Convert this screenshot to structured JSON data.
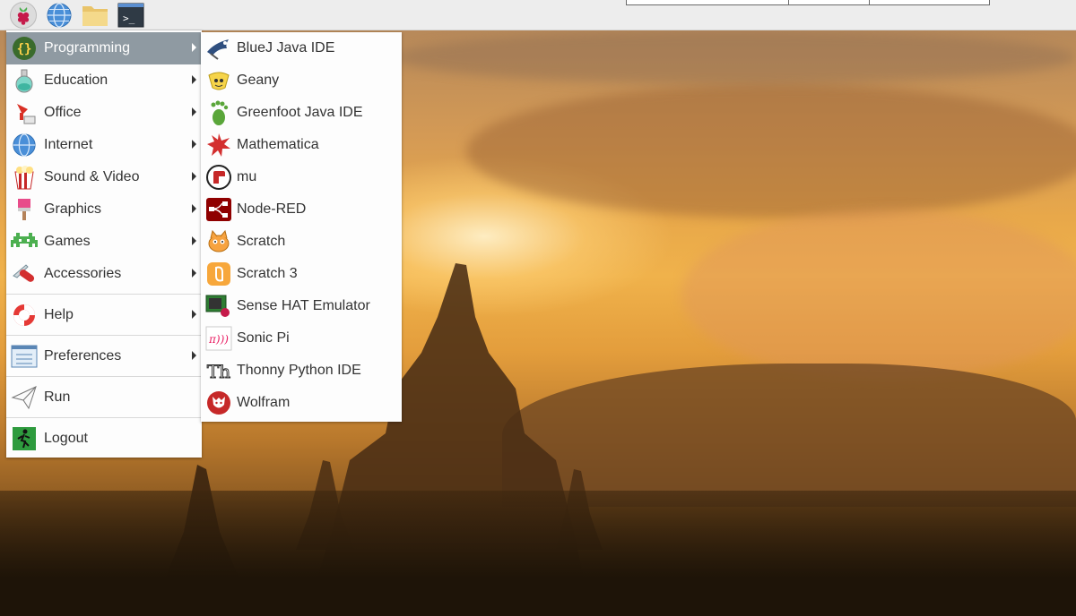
{
  "panel": {
    "buttons": [
      {
        "name": "raspberry-menu-button",
        "icon": "raspberry-icon"
      },
      {
        "name": "web-browser-button",
        "icon": "globe-icon"
      },
      {
        "name": "file-manager-button",
        "icon": "folder-icon"
      },
      {
        "name": "terminal-button",
        "icon": "terminal-icon",
        "glyph": ">_"
      }
    ]
  },
  "main_menu": {
    "items": [
      {
        "label": "Programming",
        "icon": "braces-icon",
        "submenu": true
      },
      {
        "label": "Education",
        "icon": "flask-icon",
        "submenu": true
      },
      {
        "label": "Office",
        "icon": "office-icon",
        "submenu": true
      },
      {
        "label": "Internet",
        "icon": "globe-icon",
        "submenu": true
      },
      {
        "label": "Sound & Video",
        "icon": "popcorn-icon",
        "submenu": true
      },
      {
        "label": "Graphics",
        "icon": "paintbrush-icon",
        "submenu": true
      },
      {
        "label": "Games",
        "icon": "space-invader-icon",
        "submenu": true
      },
      {
        "label": "Accessories",
        "icon": "swiss-knife-icon",
        "submenu": true
      },
      {
        "label": "Help",
        "icon": "lifebuoy-icon",
        "submenu": true
      },
      {
        "label": "Preferences",
        "icon": "preferences-icon",
        "submenu": true
      },
      {
        "label": "Run",
        "icon": "paper-plane-icon",
        "submenu": false
      },
      {
        "label": "Logout",
        "icon": "exit-icon",
        "submenu": false
      }
    ]
  },
  "sub_menu": {
    "items": [
      {
        "label": "BlueJ Java IDE",
        "icon": "bluej-icon"
      },
      {
        "label": "Geany",
        "icon": "geany-icon"
      },
      {
        "label": "Greenfoot Java IDE",
        "icon": "greenfoot-icon"
      },
      {
        "label": "Mathematica",
        "icon": "mathematica-icon"
      },
      {
        "label": "mu",
        "icon": "mu-icon"
      },
      {
        "label": "Node-RED",
        "icon": "node-red-icon"
      },
      {
        "label": "Scratch",
        "icon": "scratch-icon"
      },
      {
        "label": "Scratch 3",
        "icon": "scratch3-icon"
      },
      {
        "label": "Sense HAT Emulator",
        "icon": "sense-hat-icon"
      },
      {
        "label": "Sonic Pi",
        "icon": "sonic-pi-icon",
        "glyph": "π)))"
      },
      {
        "label": "Thonny Python IDE",
        "icon": "thonny-icon",
        "glyph": "Th"
      },
      {
        "label": "Wolfram",
        "icon": "wolfram-icon"
      }
    ]
  }
}
